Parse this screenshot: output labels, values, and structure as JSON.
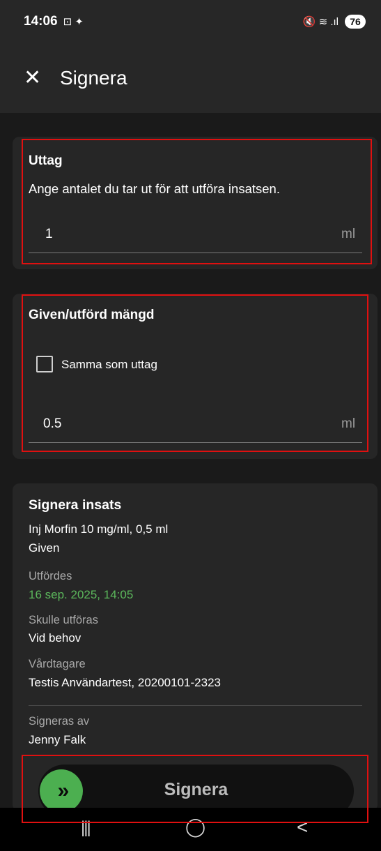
{
  "status_bar": {
    "time": "14:06",
    "notif_icons": "⊡ ✦",
    "signal_icons": "🔇 ≋ .ıl",
    "battery": "76"
  },
  "app_bar": {
    "close_icon": "close-icon",
    "title": "Signera"
  },
  "uttag": {
    "title": "Uttag",
    "description": "Ange antalet du tar ut för att utföra insatsen.",
    "value": "1",
    "unit": "ml"
  },
  "given": {
    "title": "Given/utförd mängd",
    "checkbox_label": "Samma som uttag",
    "checkbox_checked": false,
    "value": "0.5",
    "unit": "ml"
  },
  "signera_insats": {
    "title": "Signera insats",
    "line1": "Inj Morfin 10 mg/ml, 0,5 ml",
    "line2": "Given",
    "utfordes_label": "Utfördes",
    "utfordes_value": "16 sep. 2025, 14:05",
    "skulle_label": "Skulle utföras",
    "skulle_value": "Vid behov",
    "vardtagare_label": "Vårdtagare",
    "vardtagare_value": "Testis Användartest, 20200101-2323",
    "signeras_label": "Signeras av",
    "signeras_value": "Jenny Falk"
  },
  "slider": {
    "knob_icon": "double-chevron-right-icon",
    "knob_glyph": "»",
    "label": "Signera"
  },
  "nav": {
    "recents": "|||",
    "home": "◯",
    "back": "<"
  },
  "colors": {
    "accent_green": "#4caf50",
    "highlight": "#e01010"
  }
}
